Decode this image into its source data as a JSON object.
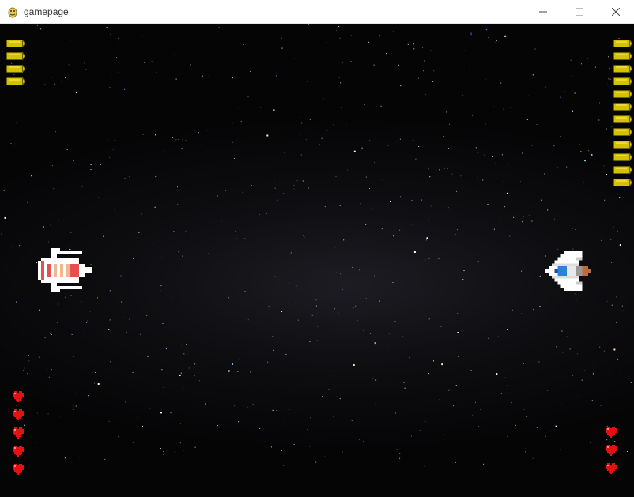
{
  "window": {
    "title": "gamepage",
    "app_icon": "pygame-snake-icon",
    "controls": [
      "minimize-icon",
      "maximize-icon",
      "close-icon"
    ]
  },
  "game": {
    "background": "starfield",
    "colors": {
      "ammo": "#d4c200",
      "ammo_outline": "#6b6200",
      "heart": "#e51010",
      "player1_accent": "#e85050",
      "player2_accent": "#2f7fe0"
    },
    "player1": {
      "icon": "red-spaceship-icon",
      "facing": "right",
      "bullets_remaining": 4,
      "lives": 5
    },
    "player2": {
      "icon": "blue-spaceship-icon",
      "facing": "left",
      "bullets_remaining": 12,
      "lives": 3
    }
  }
}
